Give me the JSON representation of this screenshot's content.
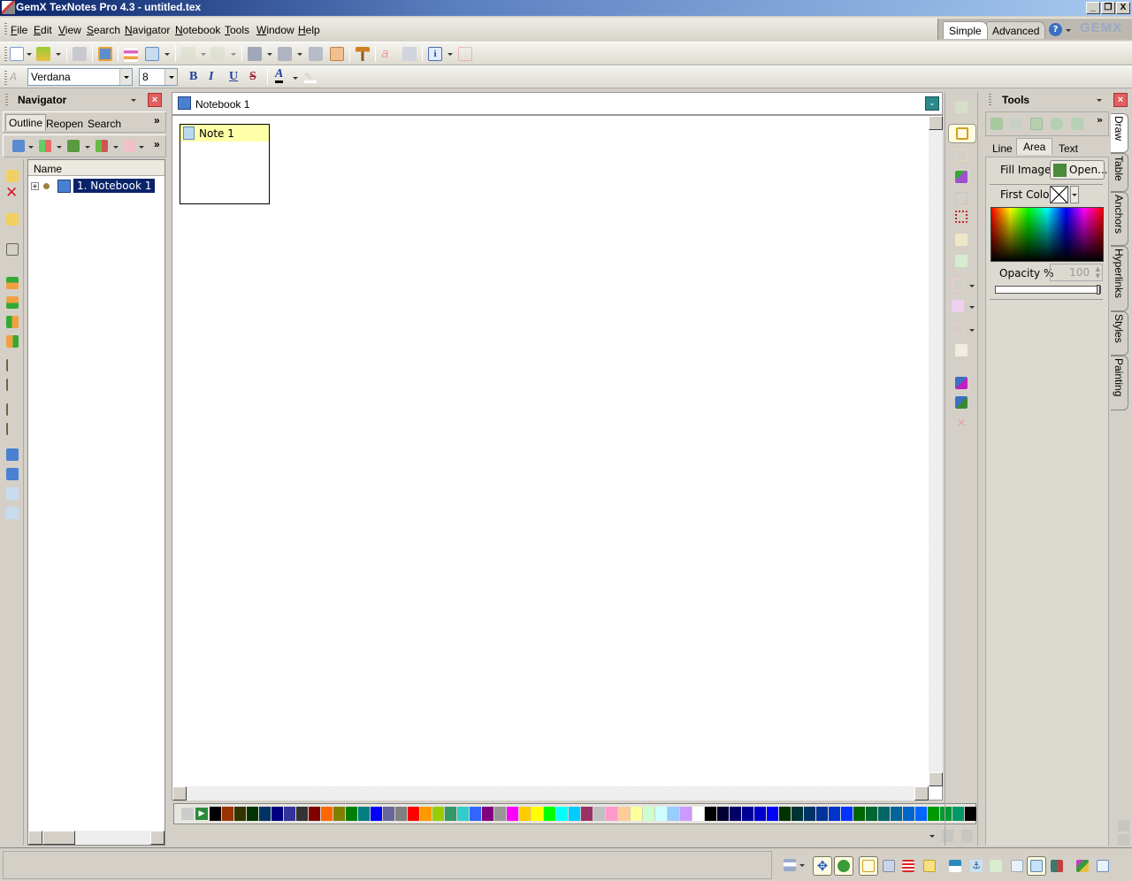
{
  "window": {
    "title": "GemX TexNotes Pro 4.3 - untitled.tex",
    "controls": [
      "minimize",
      "restore",
      "close"
    ]
  },
  "menubar": {
    "items": [
      "File",
      "Edit",
      "View",
      "Search",
      "Navigator",
      "Notebook",
      "Tools",
      "Window",
      "Help"
    ]
  },
  "mode_tabs": {
    "items": [
      "Simple",
      "Advanced"
    ],
    "selected": "Simple",
    "help_icon": "help-icon",
    "logo": "GEMX"
  },
  "toolbar": {
    "icons": [
      "new-document-icon",
      "open-folder-icon",
      "save-icon",
      "save-as-icon",
      "insert-note-icon",
      "layout-icon",
      "back-icon",
      "forward-icon",
      "print-preview-icon",
      "print-icon",
      "print-setup-icon",
      "edit-tex-icon",
      "hammer-icon",
      "spell-check-icon",
      "insert-text-icon",
      "info-icon",
      "select-region-icon"
    ]
  },
  "format_toolbar": {
    "font": "Verdana",
    "size": "8",
    "bold": "B",
    "italic": "I",
    "underline": "U",
    "strike": "S",
    "font_color_label": "A"
  },
  "navigator": {
    "title": "Navigator",
    "tabs": [
      "Outline",
      "Reopen",
      "Search"
    ],
    "selected_tab": "Outline",
    "more": "»",
    "column_header": "Name",
    "tree": [
      {
        "label": "1. Notebook 1",
        "selected": true,
        "expandable": true
      }
    ]
  },
  "document": {
    "tab_title": "Notebook 1",
    "notes": [
      {
        "title": "Note 1"
      }
    ]
  },
  "palette": {
    "colors": [
      "#000000",
      "#993300",
      "#333300",
      "#003300",
      "#003366",
      "#000080",
      "#333399",
      "#333333",
      "#800000",
      "#FF6600",
      "#808000",
      "#008000",
      "#008080",
      "#0000FF",
      "#666699",
      "#808080",
      "#FF0000",
      "#FF9900",
      "#99CC00",
      "#339966",
      "#33CCCC",
      "#3366FF",
      "#800080",
      "#969696",
      "#FF00FF",
      "#FFCC00",
      "#FFFF00",
      "#00FF00",
      "#00FFFF",
      "#00CCFF",
      "#993366",
      "#C0C0C0",
      "#FF99CC",
      "#FFCC99",
      "#FFFF99",
      "#CCFFCC",
      "#CCFFFF",
      "#99CCFF",
      "#CC99FF",
      "#FFFFFF",
      "#000000",
      "#000033",
      "#000066",
      "#000099",
      "#0000CC",
      "#0000FF",
      "#003300",
      "#003333",
      "#003366",
      "#003399",
      "#0033CC",
      "#0033FF",
      "#006600",
      "#006633",
      "#006666",
      "#006699",
      "#0066CC",
      "#0066FF",
      "#009900",
      "#009933",
      "#009966",
      "#000000"
    ]
  },
  "tools": {
    "title": "Tools",
    "subtabs": [
      "Line",
      "Area",
      "Text"
    ],
    "selected_subtab": "Area",
    "fill_image_label": "Fill Image:",
    "open_button": "Open...",
    "first_color_label": "First Color",
    "opacity_label": "Opacity %",
    "opacity_value": "100",
    "opacity_percent": 100,
    "side_tabs": [
      "Draw",
      "Table",
      "Anchors",
      "Hyperlinks",
      "Styles",
      "Painting"
    ],
    "selected_side_tab": "Draw"
  }
}
